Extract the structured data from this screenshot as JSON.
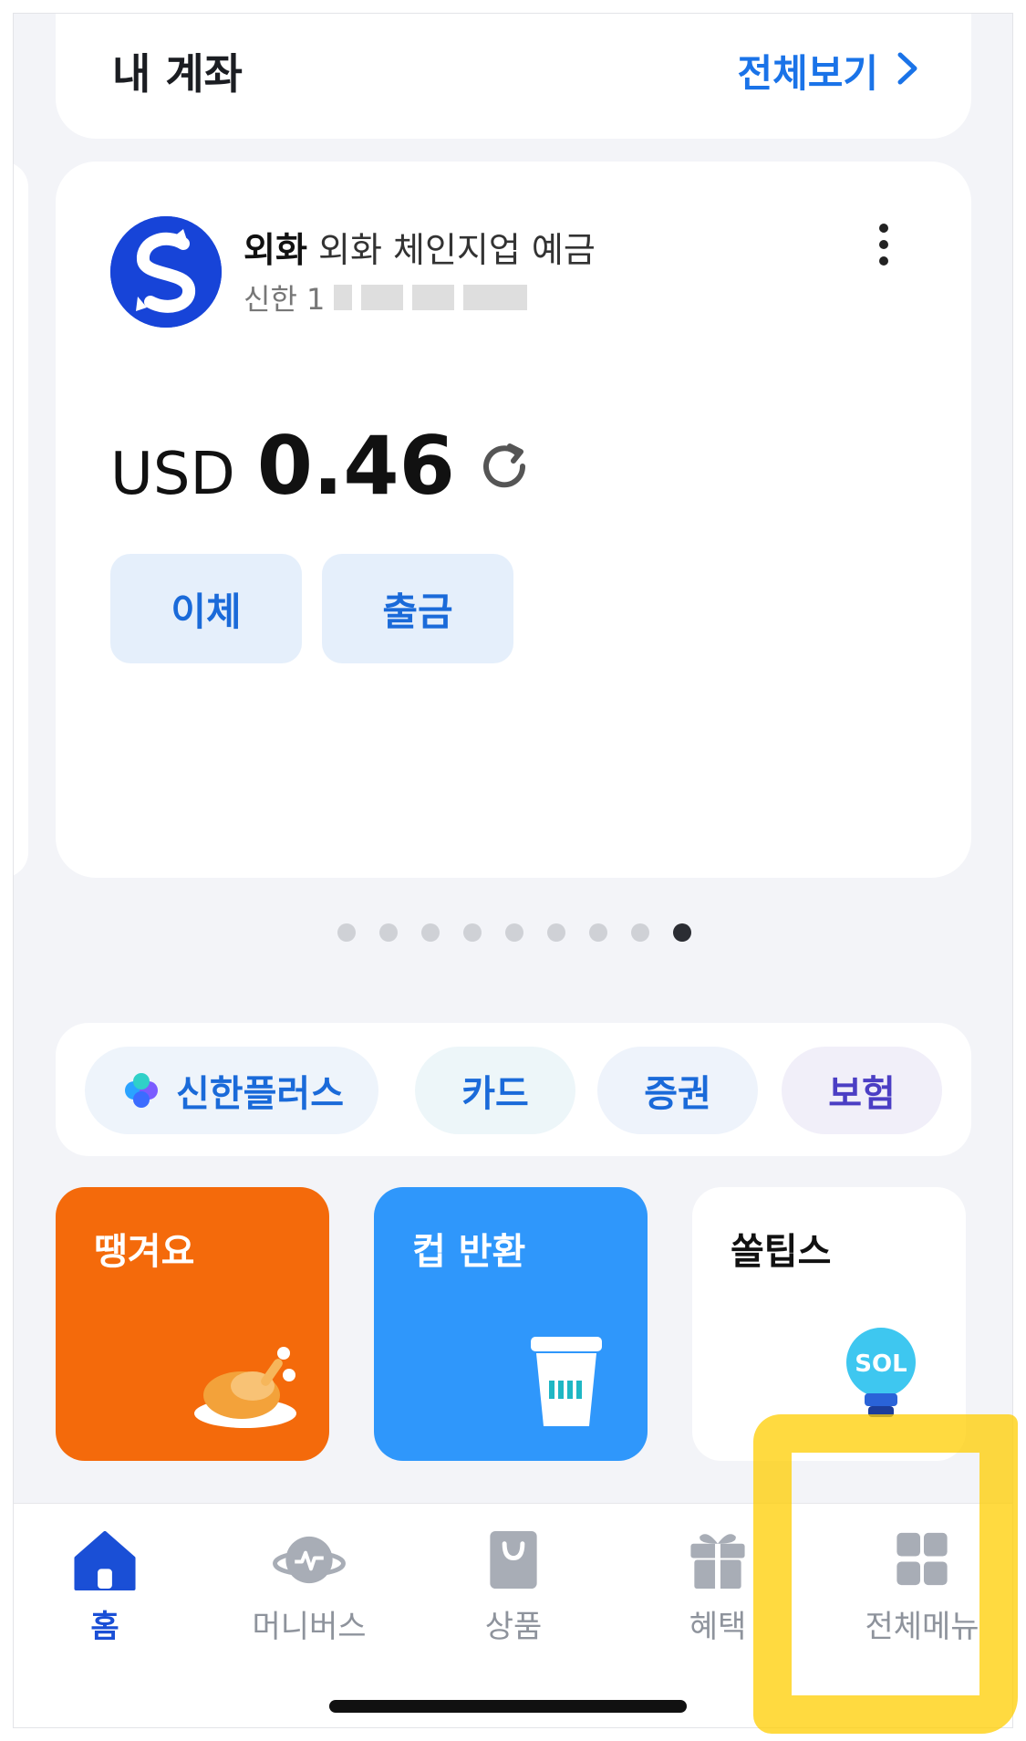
{
  "my_accounts": {
    "title": "내 계좌",
    "view_all": "전체보기",
    "view_all_chevron": "›"
  },
  "account": {
    "type": "외화",
    "name": "외화 체인지업 예금",
    "number_prefix": "신한 1",
    "currency": "USD",
    "balance": "0.46",
    "actions": [
      "이체",
      "출금"
    ],
    "logo_color": "#1744d8"
  },
  "pager": {
    "total": 9,
    "active_index": 8
  },
  "chips": {
    "plus": "신한플러스",
    "card": "카드",
    "securities": "증권",
    "insurance": "보험"
  },
  "tiles": {
    "ttang": {
      "title": "땡겨요",
      "icon": "roast-chicken-icon",
      "color": "#f46a0b"
    },
    "cup_return": {
      "title": "컵 반환",
      "icon": "cup-icon",
      "color": "#2f97fb"
    },
    "sol_tips": {
      "title": "쏠팁스",
      "icon": "sol-lightbulb-icon"
    }
  },
  "bottom_nav": {
    "home": "홈",
    "moneyverse": "머니버스",
    "products": "상품",
    "benefits": "혜택",
    "all_menu": "전체메뉴",
    "active": "home",
    "active_color": "#1a4fd6"
  }
}
